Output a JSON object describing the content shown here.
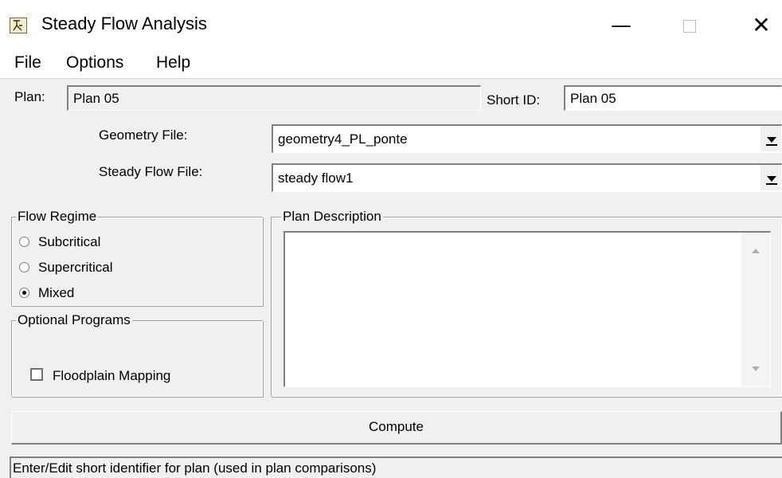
{
  "window": {
    "title": "Steady Flow Analysis",
    "minimize_glyph": "—",
    "close_glyph": "✕"
  },
  "menu": [
    "File",
    "Options",
    "Help"
  ],
  "plan": {
    "label": "Plan:",
    "value": "Plan 05",
    "short_id_label": "Short ID:",
    "short_id_value": "Plan 05"
  },
  "geometry": {
    "label": "Geometry File:",
    "value": "geometry4_PL_ponte"
  },
  "steady_flow": {
    "label": "Steady Flow File:",
    "value": "steady flow1"
  },
  "flow_regime": {
    "title": "Flow Regime",
    "options": [
      {
        "label": "Subcritical",
        "selected": false
      },
      {
        "label": "Supercritical",
        "selected": false
      },
      {
        "label": "Mixed",
        "selected": true
      }
    ]
  },
  "optional_programs": {
    "title": "Optional Programs",
    "floodplain_mapping_label": "Floodplain Mapping",
    "floodplain_mapping_checked": false
  },
  "plan_description": {
    "title": "Plan Description",
    "value": ""
  },
  "compute_label": "Compute",
  "status_text": "Enter/Edit short identifier for plan (used in plan comparisons)",
  "icons": {
    "app": "steady-flow-app-icon",
    "scroll_up": "scroll-up-arrow-icon",
    "scroll_down": "scroll-down-arrow-icon",
    "dropdown": "chevron-down-icon"
  }
}
